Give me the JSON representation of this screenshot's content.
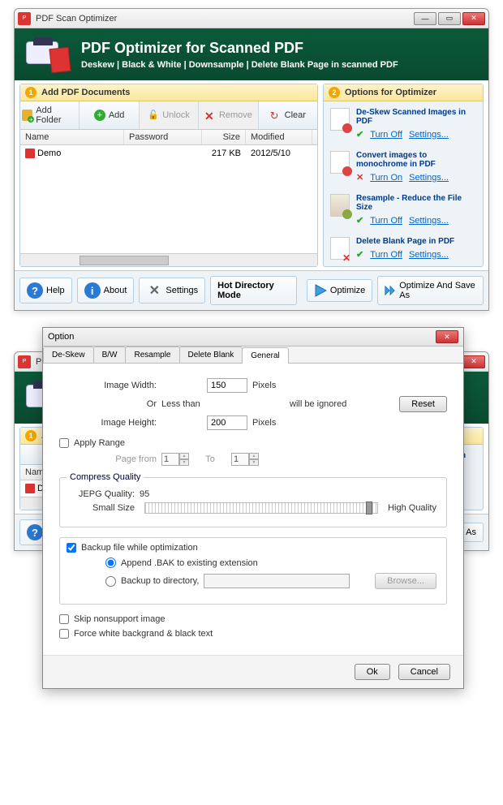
{
  "window1": {
    "title": "PDF Scan Optimizer",
    "banner_title": "PDF Optimizer for Scanned PDF",
    "banner_sub": "Deskew | Black & White | Downsample | Delete Blank Page in scanned PDF",
    "left_header": "Add PDF Documents",
    "right_header": "Options for Optimizer",
    "toolbar": {
      "add_folder": "Add Folder",
      "add": "Add",
      "unlock": "Unlock",
      "remove": "Remove",
      "clear": "Clear"
    },
    "columns": {
      "name": "Name",
      "password": "Password",
      "size": "Size",
      "modified": "Modified"
    },
    "rows": [
      {
        "name": "Demo",
        "password": "",
        "size": "217 KB",
        "modified": "2012/5/10"
      }
    ],
    "options": [
      {
        "title": "De-Skew Scanned Images in PDF",
        "on": true,
        "toggle": "Turn Off",
        "settings": "Settings..."
      },
      {
        "title": "Convert images to monochrome in PDF",
        "on": false,
        "toggle": "Turn On",
        "settings": "Settings..."
      },
      {
        "title": "Resample - Reduce the File Size",
        "on": true,
        "toggle": "Turn Off",
        "settings": "Settings..."
      },
      {
        "title": "Delete Blank Page in PDF",
        "on": true,
        "toggle": "Turn Off",
        "settings": "Settings..."
      }
    ],
    "footer": {
      "help": "Help",
      "about": "About",
      "settings": "Settings",
      "hot": "Hot Directory Mode",
      "optimize": "Optimize",
      "optimize_save": "Optimize And Save As"
    }
  },
  "dialog": {
    "title": "Option",
    "tabs": [
      "De-Skew",
      "B/W",
      "Resample",
      "Delete Blank",
      "General"
    ],
    "active_tab": "General",
    "image_width_lbl": "Image Width:",
    "or": "Or",
    "less_than": "Less than",
    "image_height_lbl": "Image Height:",
    "width_val": "150",
    "height_val": "200",
    "pixels": "Pixels",
    "ignored": "will be ignored",
    "reset": "Reset",
    "apply_range": "Apply Range",
    "page_from": "Page from",
    "to": "To",
    "pf_val": "1",
    "pt_val": "1",
    "compress": "Compress Quality",
    "jpeg_lbl": "JEPG Quality:",
    "jpeg_val": "95",
    "small": "Small Size",
    "high": "High Quality",
    "backup": "Backup file while optimization",
    "append": "Append .BAK to existing  extension",
    "backup_dir": "Backup to directory,",
    "browse": "Browse...",
    "skip": "Skip nonsupport image",
    "force": "Force white backgrand & black text",
    "ok": "Ok",
    "cancel": "Cancel"
  }
}
